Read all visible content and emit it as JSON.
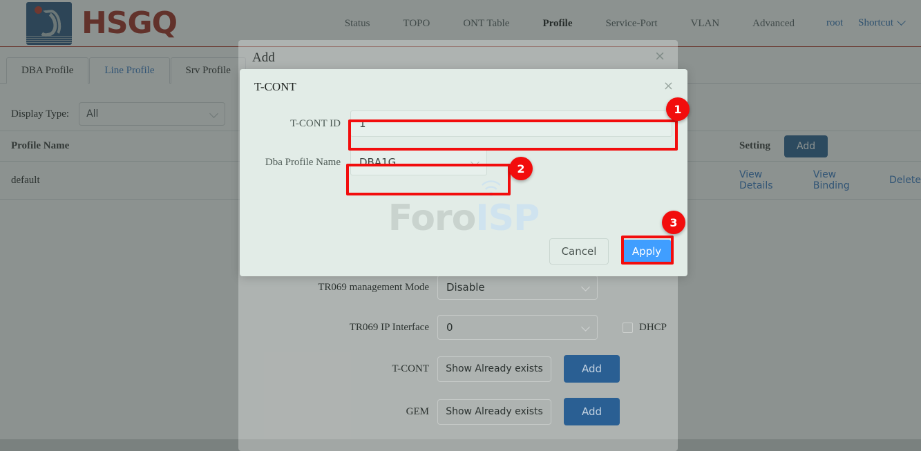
{
  "header": {
    "logo_text": "HSGQ",
    "logo_icon": "hsgq-logo-icon",
    "nav": [
      {
        "label": "Status",
        "active": false
      },
      {
        "label": "TOPO",
        "active": false
      },
      {
        "label": "ONT Table",
        "active": false
      },
      {
        "label": "Profile",
        "active": true
      },
      {
        "label": "Service-Port",
        "active": false
      },
      {
        "label": "VLAN",
        "active": false
      },
      {
        "label": "Advanced",
        "active": false
      }
    ],
    "user": "root",
    "shortcut": "Shortcut"
  },
  "tabs": [
    {
      "label": "DBA Profile",
      "active": false
    },
    {
      "label": "Line Profile",
      "active": true
    },
    {
      "label": "Srv Profile",
      "active": false
    }
  ],
  "filter": {
    "label": "Display Type:",
    "value": "All"
  },
  "table": {
    "columns": {
      "profile_name": "Profile Name",
      "setting": "Setting"
    },
    "header_add_button": "Add",
    "rows": [
      {
        "profile_name": "default",
        "actions": [
          "View Details",
          "View Binding",
          "Delete"
        ]
      }
    ]
  },
  "add_modal": {
    "title": "Add",
    "close_icon": "×",
    "fields": [
      {
        "label": "TR069 management Mode",
        "value": "Disable",
        "type": "select"
      },
      {
        "label": "TR069 IP Interface",
        "value": "0",
        "type": "select",
        "checkbox_label": "DHCP",
        "checkbox_checked": false
      },
      {
        "label": "T-CONT",
        "button": "Show Already exists",
        "add_button": "Add"
      },
      {
        "label": "GEM",
        "button": "Show Already exists",
        "add_button": "Add"
      }
    ]
  },
  "tcont_modal": {
    "title": "T-CONT",
    "close_icon": "×",
    "fields": [
      {
        "label": "T-CONT ID",
        "value": "1",
        "type": "input"
      },
      {
        "label": "Dba Profile Name",
        "value": "DBA1G",
        "type": "select"
      }
    ],
    "cancel_button": "Cancel",
    "apply_button": "Apply"
  },
  "watermark": {
    "part1": "Foro",
    "part2": "ISP"
  },
  "annotations": [
    {
      "number": "1",
      "target": "tcont-id-input"
    },
    {
      "number": "2",
      "target": "dba-profile-name-select"
    },
    {
      "number": "3",
      "target": "apply-button"
    }
  ],
  "colors": {
    "brand_red": "#a32b20",
    "logo_blue": "#2d5582",
    "link_blue": "#3577c4",
    "button_blue": "#2a5f93",
    "apply_blue": "#409eff",
    "highlight_red": "#f20d0d",
    "modal_bg": "#e2ece7"
  }
}
